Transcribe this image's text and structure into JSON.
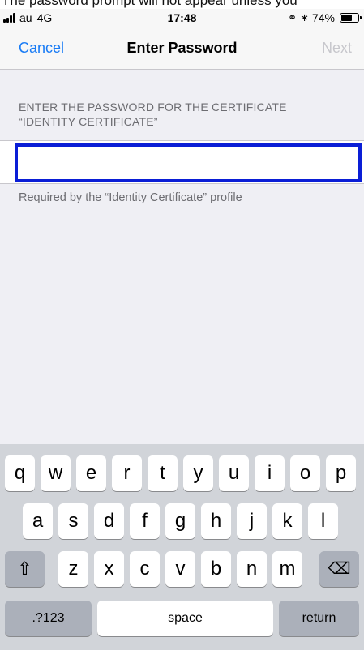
{
  "caption": "The password prompt will not appear unless you",
  "status_bar": {
    "carrier": "au",
    "network": "4G",
    "time": "17:48",
    "battery": "74%",
    "battery_level": 0.74,
    "icons": [
      "signal-bars-icon",
      "orientation-lock-icon",
      "bluetooth-icon",
      "battery-icon"
    ]
  },
  "nav": {
    "cancel_label": "Cancel",
    "title": "Enter Password",
    "next_label": "Next",
    "accent_color": "#1a7cf5",
    "disabled_color": "#c7c7cc"
  },
  "form": {
    "section_header_line1": "ENTER THE PASSWORD FOR THE CERTIFICATE",
    "section_header_line2": "“IDENTITY CERTIFICATE”",
    "password_value": "",
    "highlight_color": "#0a1ed6",
    "footer": "Required by the “Identity Certificate” profile"
  },
  "keyboard": {
    "row1": [
      "q",
      "w",
      "e",
      "r",
      "t",
      "y",
      "u",
      "i",
      "o",
      "p"
    ],
    "row2": [
      "a",
      "s",
      "d",
      "f",
      "g",
      "h",
      "j",
      "k",
      "l"
    ],
    "row3": [
      "z",
      "x",
      "c",
      "v",
      "b",
      "n",
      "m"
    ],
    "shift_glyph": "⇧",
    "delete_glyph": "⌫",
    "numbers_label": ".?123",
    "space_label": "space",
    "return_label": "return"
  }
}
